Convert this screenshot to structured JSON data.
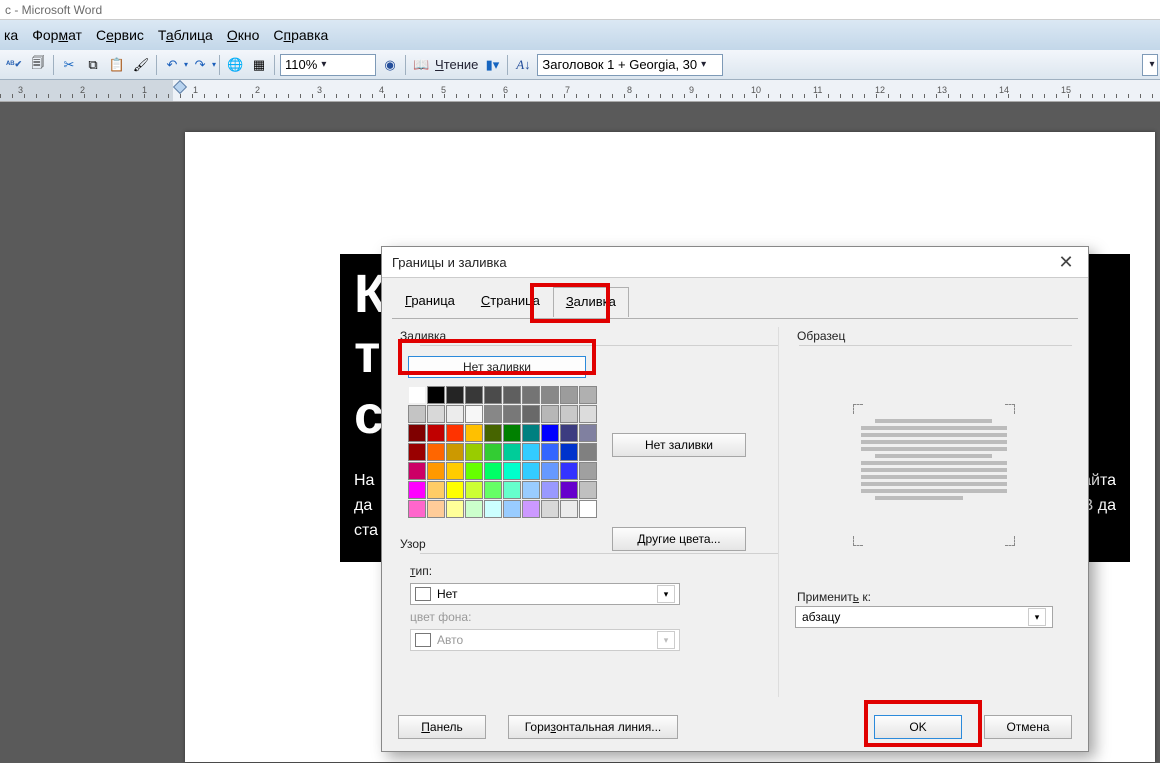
{
  "titlebar": "с - Microsoft Word",
  "menu": {
    "items": [
      "ка",
      "Формат",
      "Сервис",
      "Таблица",
      "Окно",
      "Справка"
    ],
    "keys": [
      "к",
      "м",
      "е",
      "а",
      "к",
      "п"
    ]
  },
  "toolbar": {
    "zoom": "110%",
    "reading": "Чтение",
    "style": "Заголовок 1 + Georgia, 30"
  },
  "ruler": {
    "start": 3,
    "end": 15,
    "margin_at": 0
  },
  "document": {
    "heading_fragments": [
      "К",
      "т",
      "с"
    ],
    "body_fragments_left": [
      "На",
      "да",
      "ста"
    ],
    "body_fragments_right": [
      "о сайта",
      "ета. В да"
    ]
  },
  "dialog": {
    "title": "Границы и заливка",
    "tabs": {
      "border": "Граница",
      "page": "Страница",
      "fill": "Заливка"
    },
    "fill_section": "Заливка",
    "no_fill": "Нет заливки",
    "no_fill_btn": "Нет заливки",
    "other_colors": "Другие цвета...",
    "pattern_section": "Узор",
    "type_label": "тип:",
    "type_value": "Нет",
    "bg_label": "цвет фона:",
    "bg_value": "Авто",
    "sample_label": "Образец",
    "apply_label": "Применить к:",
    "apply_value": "абзацу",
    "panel": "Панель",
    "hline": "Горизонтальная линия...",
    "ok": "OK",
    "cancel": "Отмена"
  },
  "palette": [
    [
      "#ffffff",
      "#000000",
      "#242424",
      "#383838",
      "#4b4b4b",
      "#5f5f5f",
      "#747474",
      "#888888",
      "#9c9c9c",
      "#b0b0b0"
    ],
    [
      "#c4c4c4",
      "#d8d8d8",
      "#ececec",
      "#f7f7f7",
      "#878787",
      "#787878",
      "#696969",
      "#b7b7b7",
      "#c9c9c9",
      "#dcdcdc"
    ],
    [
      "#7f0000",
      "#c00000",
      "#ff3300",
      "#ffc000",
      "#466400",
      "#008000",
      "#008080",
      "#0000ff",
      "#3c3c80",
      "#8080a0"
    ],
    [
      "#990000",
      "#ff6600",
      "#cc9900",
      "#99cc00",
      "#33cc33",
      "#00cc99",
      "#33ccff",
      "#3366ff",
      "#0033cc",
      "#808080"
    ],
    [
      "#cc0066",
      "#ff9900",
      "#ffcc00",
      "#66ff00",
      "#00ff66",
      "#00ffcc",
      "#33ccff",
      "#6699ff",
      "#3333ff",
      "#a0a0a0"
    ],
    [
      "#ff00ff",
      "#ffcc66",
      "#ffff00",
      "#ccff33",
      "#66ff66",
      "#66ffcc",
      "#99ccff",
      "#9999ff",
      "#6600cc",
      "#c0c0c0"
    ],
    [
      "#ff66cc",
      "#ffcc99",
      "#ffff99",
      "#ccffcc",
      "#ccffff",
      "#99ccff",
      "#cc99ff",
      "#d8d8d8",
      "#ececec",
      "#ffffff"
    ]
  ]
}
